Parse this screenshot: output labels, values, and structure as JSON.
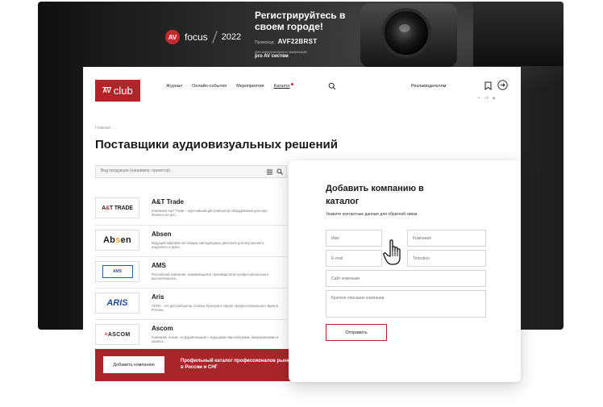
{
  "banner": {
    "logo_badge": "AV",
    "logo_word": "focus",
    "logo_year": "2022",
    "headline": "Регистрируйтесь в своем городе!",
    "promo_label": "Промокод:",
    "promo_code": "AVF22BRST",
    "audience_line": "для интеграторов и заказчиков",
    "audience_strong": "pro AV систем"
  },
  "nav": {
    "logo_small": "AV",
    "logo_text": "club",
    "links": [
      "Журнал",
      "Онлайн-события",
      "Мероприятия",
      "Каталог"
    ],
    "advertisers": "Рекламодателям",
    "socials": [
      "✈",
      "vk",
      "▶"
    ]
  },
  "breadcrumb": {
    "label": "Главная"
  },
  "page_title": "Поставщики аудиовизуальных решений",
  "search": {
    "placeholder": "Вид продукции (например: проектор)"
  },
  "companies": [
    {
      "name": "A&T Trade",
      "desc": "Компания A&T Trade – крупнейший дистрибьютор оборудования для шоу-бизнеса на рос..."
    },
    {
      "name": "Absen",
      "desc": "Ведущий мировой поставщик светодиодных дисплеев для внутреннего, наружного и арен..."
    },
    {
      "name": "AMS",
      "desc": "Российская компания, занимающаяся производством профессионального высокотехнолог..."
    },
    {
      "name": "Aris",
      "desc": "АРИС - это дистрибьютор готовых брендов в сфере профессионального звука в России..."
    },
    {
      "name": "Ascom",
      "desc": "Компания Аском, сотрудничающая с ведущими европейскими, американскими и азиатск..."
    }
  ],
  "cta": {
    "button": "Добавить компанию",
    "text": "Профильный каталог профессионалов рынка AV в России и СНГ"
  },
  "form": {
    "title": "Добавить компанию в каталог",
    "hint": "Укажите контактные данные для обратной связи.",
    "name_placeholder": "Имя",
    "company_placeholder": "Компания",
    "email_placeholder": "E-mail",
    "phone_placeholder": "Телефон",
    "site_placeholder": "Сайт компании",
    "description_placeholder": "Краткое описание компании",
    "submit": "Отправить"
  },
  "colors": {
    "brand_red": "#b32428",
    "cta_red": "#a8262a",
    "banner_dark": "#1c1c1c"
  }
}
